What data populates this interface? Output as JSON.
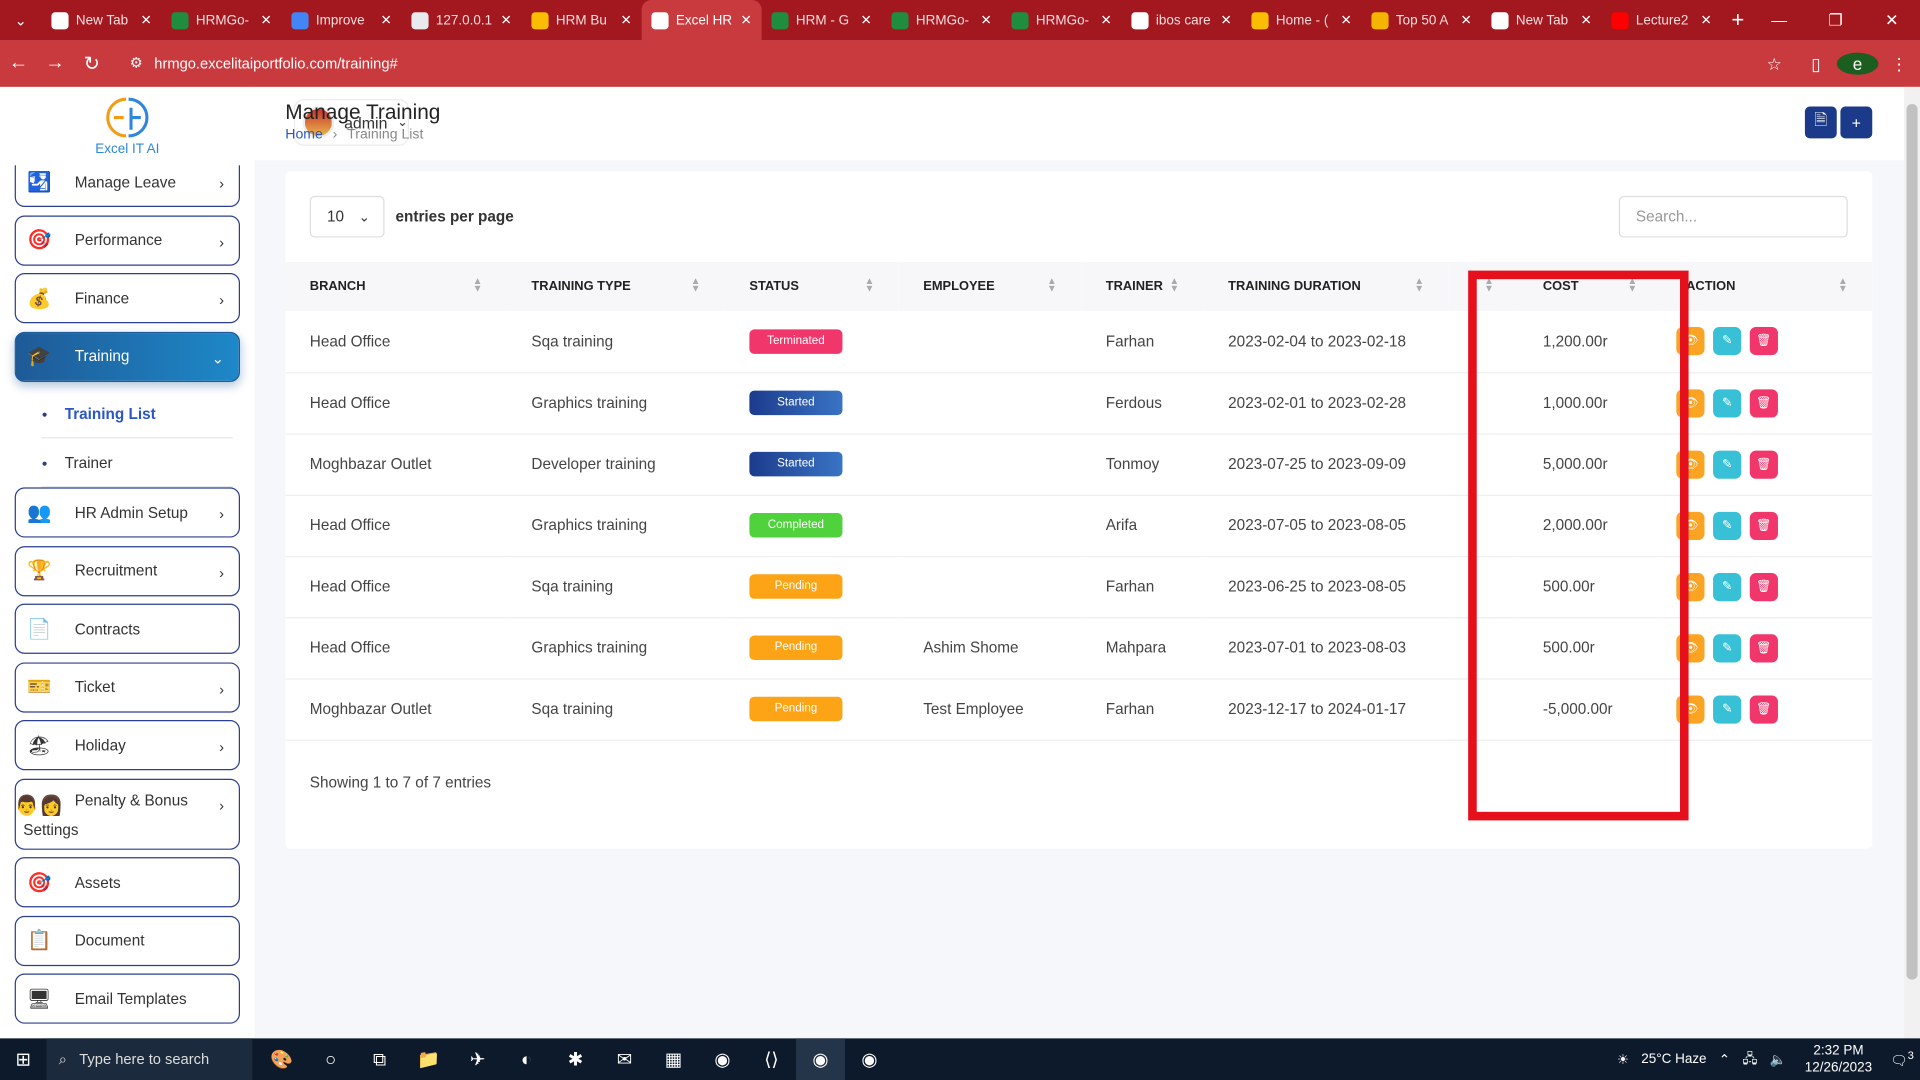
{
  "browser": {
    "tabs": [
      {
        "title": "New Tab",
        "color": "#ffffff",
        "active": false
      },
      {
        "title": "HRMGo-",
        "color": "#1e8e3e",
        "active": false
      },
      {
        "title": "Improve",
        "color": "#4285f4",
        "active": false
      },
      {
        "title": "127.0.0.1",
        "color": "#e8eaed",
        "active": false
      },
      {
        "title": "HRM Bu",
        "color": "#fbbc04",
        "active": false
      },
      {
        "title": "Excel HR",
        "color": "#ffffff",
        "active": true
      },
      {
        "title": "HRM - G",
        "color": "#1e8e3e",
        "active": false
      },
      {
        "title": "HRMGo-",
        "color": "#1e8e3e",
        "active": false
      },
      {
        "title": "HRMGo-",
        "color": "#1e8e3e",
        "active": false
      },
      {
        "title": "ibos care",
        "color": "#ffffff",
        "active": false
      },
      {
        "title": "Home - (",
        "color": "#fbbc04",
        "active": false
      },
      {
        "title": "Top 50 A",
        "color": "#f4b400",
        "active": false
      },
      {
        "title": "New Tab",
        "color": "#ffffff",
        "active": false
      },
      {
        "title": "Lecture2",
        "color": "#ff0000",
        "active": false
      }
    ],
    "url": "hrmgo.excelitaiportfolio.com/training#",
    "profile_initial": "e"
  },
  "brand": {
    "name": "Excel IT AI"
  },
  "sidebar": {
    "items": [
      {
        "label": "Manage Leave",
        "icon": "leave-icon",
        "glyph": "🛂",
        "chevron": true
      },
      {
        "label": "Performance",
        "icon": "performance-icon",
        "glyph": "🎯",
        "chevron": true
      },
      {
        "label": "Finance",
        "icon": "finance-icon",
        "glyph": "💰",
        "chevron": true
      },
      {
        "label": "Training",
        "icon": "training-icon",
        "glyph": "🎓",
        "chevron": true,
        "active": true
      },
      {
        "label": "HR Admin Setup",
        "icon": "hr-admin-icon",
        "glyph": "👥",
        "chevron": true
      },
      {
        "label": "Recruitment",
        "icon": "recruitment-icon",
        "glyph": "🏆",
        "chevron": true
      },
      {
        "label": "Contracts",
        "icon": "contracts-icon",
        "glyph": "📄",
        "chevron": false
      },
      {
        "label": "Ticket",
        "icon": "ticket-icon",
        "glyph": "🎫",
        "chevron": true
      },
      {
        "label": "Holiday",
        "icon": "holiday-icon",
        "glyph": "🏖",
        "chevron": true
      },
      {
        "label": "Penalty & Bonus",
        "label2": "Settings",
        "icon": "penalty-bonus-icon",
        "glyph": "👨‍👩",
        "chevron": true
      },
      {
        "label": "Assets",
        "icon": "assets-icon",
        "glyph": "🎯",
        "chevron": false
      },
      {
        "label": "Document",
        "icon": "document-icon",
        "glyph": "📋",
        "chevron": false
      },
      {
        "label": "Email Templates",
        "icon": "email-templates-icon",
        "glyph": "🖥",
        "chevron": false
      }
    ],
    "training_sub": [
      {
        "label": "Training List",
        "active": true
      },
      {
        "label": "Trainer",
        "active": false
      }
    ]
  },
  "topbar": {
    "user": "admin"
  },
  "page": {
    "title": "Manage Training",
    "breadcrumb": {
      "home": "Home",
      "current": "Training List"
    }
  },
  "table": {
    "per_page": "10",
    "per_page_label": "entries per page",
    "search_placeholder": "Search...",
    "columns": [
      "Branch",
      "Training Type",
      "Status",
      "Employee",
      "Trainer",
      "Training Duration",
      "",
      "Cost",
      "Action"
    ],
    "rows": [
      {
        "branch": "Head Office",
        "type": "Sqa training",
        "status": "Terminated",
        "status_kind": "term",
        "employee": "",
        "trainer": "Farhan",
        "duration": "2023-02-04 to 2023-02-18",
        "cost": "1,200.00r"
      },
      {
        "branch": "Head Office",
        "type": "Graphics training",
        "status": "Started",
        "status_kind": "start",
        "employee": "",
        "trainer": "Ferdous",
        "duration": "2023-02-01 to 2023-02-28",
        "cost": "1,000.00r"
      },
      {
        "branch": "Moghbazar Outlet",
        "type": "Developer training",
        "status": "Started",
        "status_kind": "start",
        "employee": "",
        "trainer": "Tonmoy",
        "duration": "2023-07-25 to 2023-09-09",
        "cost": "5,000.00r"
      },
      {
        "branch": "Head Office",
        "type": "Graphics training",
        "status": "Completed",
        "status_kind": "done",
        "employee": "",
        "trainer": "Arifa",
        "duration": "2023-07-05 to 2023-08-05",
        "cost": "2,000.00r"
      },
      {
        "branch": "Head Office",
        "type": "Sqa training",
        "status": "Pending",
        "status_kind": "pend",
        "employee": "",
        "trainer": "Farhan",
        "duration": "2023-06-25 to 2023-08-05",
        "cost": "500.00r"
      },
      {
        "branch": "Head Office",
        "type": "Graphics training",
        "status": "Pending",
        "status_kind": "pend",
        "employee": "Ashim Shome",
        "trainer": "Mahpara",
        "duration": "2023-07-01 to 2023-08-03",
        "cost": "500.00r"
      },
      {
        "branch": "Moghbazar Outlet",
        "type": "Sqa training",
        "status": "Pending",
        "status_kind": "pend",
        "employee": "Test Employee",
        "trainer": "Farhan",
        "duration": "2023-12-17 to 2024-01-17",
        "cost": "-5,000.00r"
      }
    ],
    "showing": "Showing 1 to 7 of 7 entries"
  },
  "taskbar": {
    "search_placeholder": "Type here to search",
    "weather": "25°C  Haze",
    "time": "2:32 PM",
    "date": "12/26/2023",
    "notifications": "3"
  },
  "colors": {
    "brand_red": "#c93a3f",
    "accent_blue": "#1b3a8a",
    "highlight": "#e5101c"
  }
}
